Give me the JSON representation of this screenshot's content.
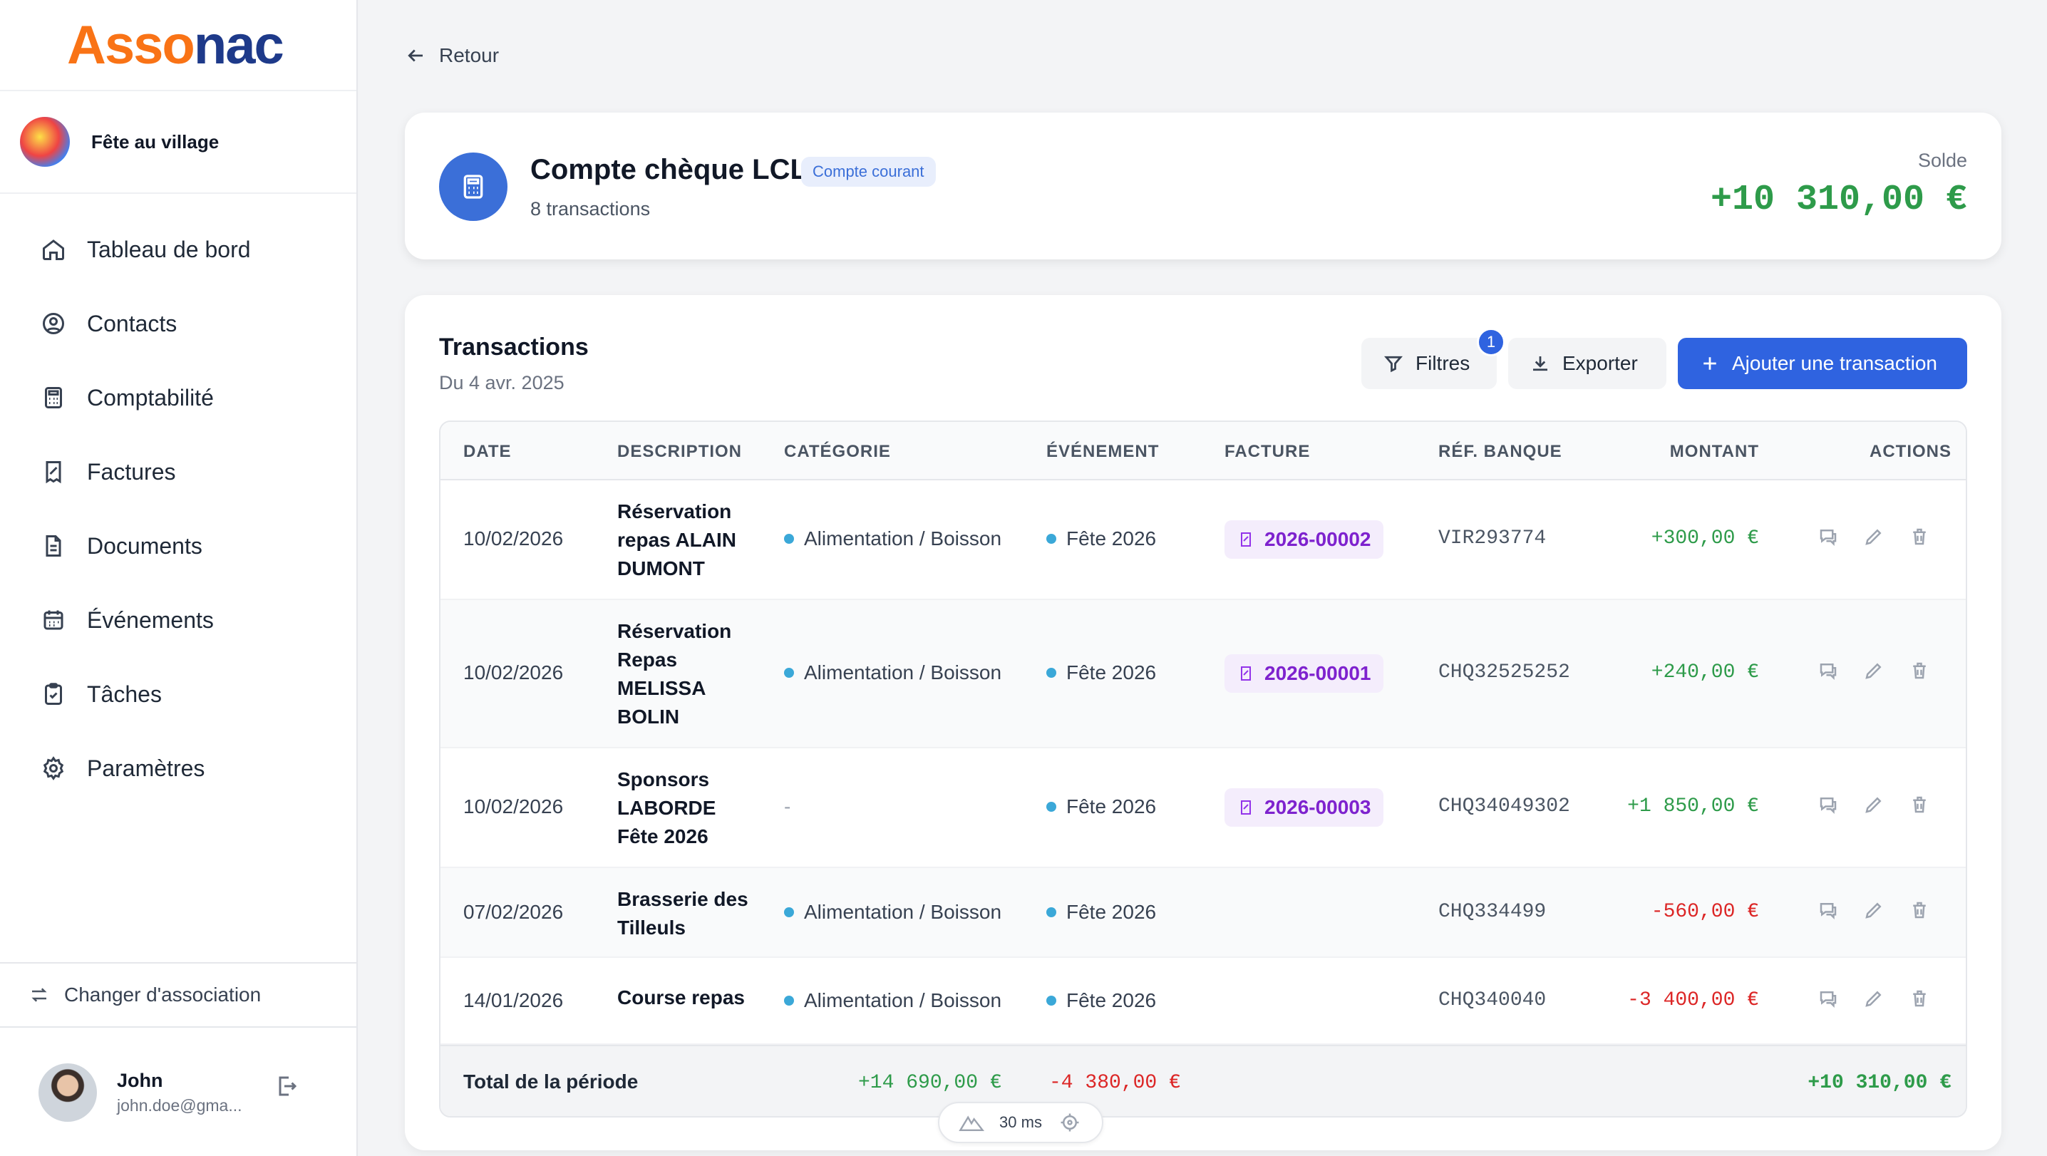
{
  "app": {
    "logo": "Assonac"
  },
  "association": {
    "name": "Fête au village"
  },
  "nav": [
    {
      "label": "Tableau de bord",
      "icon": "home-icon"
    },
    {
      "label": "Contacts",
      "icon": "user-circle-icon"
    },
    {
      "label": "Comptabilité",
      "icon": "calculator-icon"
    },
    {
      "label": "Factures",
      "icon": "receipt-icon"
    },
    {
      "label": "Documents",
      "icon": "document-icon"
    },
    {
      "label": "Événements",
      "icon": "calendar-icon"
    },
    {
      "label": "Tâches",
      "icon": "clipboard-check-icon"
    },
    {
      "label": "Paramètres",
      "icon": "gear-icon"
    }
  ],
  "switch_association": "Changer d'association",
  "user": {
    "name": "John",
    "email": "john.doe@gma..."
  },
  "back_label": "Retour",
  "account": {
    "title": "Compte chèque LCL",
    "badge": "Compte courant",
    "subtitle": "8 transactions",
    "balance_label": "Solde",
    "balance": "+10 310,00 €"
  },
  "transactions": {
    "title": "Transactions",
    "period": "Du 4 avr. 2025",
    "filters_label": "Filtres",
    "filters_count": "1",
    "export_label": "Exporter",
    "add_label": "Ajouter une transaction",
    "columns": [
      "DATE",
      "DESCRIPTION",
      "CATÉGORIE",
      "ÉVÉNEMENT",
      "FACTURE",
      "RÉF. BANQUE",
      "MONTANT",
      "ACTIONS"
    ],
    "rows": [
      {
        "date": "10/02/2026",
        "description": "Réservation repas ALAIN DUMONT",
        "category": "Alimentation / Boisson",
        "event": "Fête 2026",
        "invoice": "2026-00002",
        "ref": "VIR293774",
        "amount": "+300,00 €",
        "sign": "pos"
      },
      {
        "date": "10/02/2026",
        "description": "Réservation Repas MELISSA BOLIN",
        "category": "Alimentation / Boisson",
        "event": "Fête 2026",
        "invoice": "2026-00001",
        "ref": "CHQ32525252",
        "amount": "+240,00 €",
        "sign": "pos"
      },
      {
        "date": "10/02/2026",
        "description": "Sponsors LABORDE Fête 2026",
        "category": "-",
        "event": "Fête 2026",
        "invoice": "2026-00003",
        "ref": "CHQ34049302",
        "amount": "+1 850,00 €",
        "sign": "pos"
      },
      {
        "date": "07/02/2026",
        "description": "Brasserie des Tilleuls",
        "category": "Alimentation / Boisson",
        "event": "Fête 2026",
        "invoice": "",
        "ref": "CHQ334499",
        "amount": "-560,00 €",
        "sign": "neg"
      },
      {
        "date": "14/01/2026",
        "description": "Course repas",
        "category": "Alimentation / Boisson",
        "event": "Fête 2026",
        "invoice": "",
        "ref": "CHQ340040",
        "amount": "-3 400,00 €",
        "sign": "neg"
      }
    ],
    "totals": {
      "label": "Total de la période",
      "income": "+14 690,00 €",
      "expense": "-4 380,00 €",
      "net": "+10 310,00 €"
    }
  },
  "devbar": {
    "timing": "30 ms"
  },
  "colors": {
    "primary": "#2f63e0",
    "positive": "#2e9b4a",
    "negative": "#dc2626",
    "invoice": "#7e22ce",
    "brand_orange": "#f97316"
  }
}
